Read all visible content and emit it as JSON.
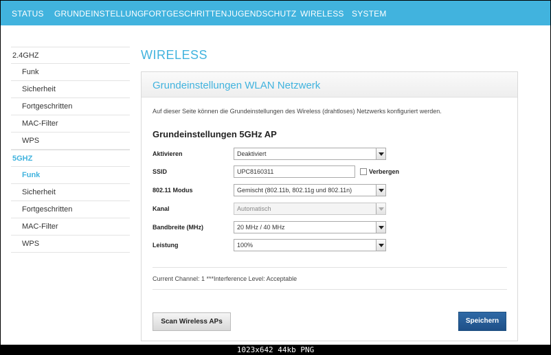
{
  "topnav": {
    "items": [
      "STATUS",
      "GRUNDEINSTELLUNG",
      "FORTGESCHRITTEN",
      "JUGENDSCHUTZ",
      "WIRELESS",
      "SYSTEM"
    ]
  },
  "sidebar": {
    "section_24": "2.4GHZ",
    "items_24": [
      "Funk",
      "Sicherheit",
      "Fortgeschritten",
      "MAC-Filter",
      "WPS"
    ],
    "section_5": "5GHZ",
    "items_5": [
      "Funk",
      "Sicherheit",
      "Fortgeschritten",
      "MAC-Filter",
      "WPS"
    ]
  },
  "page_title": "WIRELESS",
  "panel": {
    "title": "Grundeinstellungen WLAN Netzwerk",
    "description": "Auf dieser Seite können die Grundeinstellungen des Wireless (drahtloses) Netzwerks konfiguriert werden.",
    "subtitle": "Grundeinstellungen 5GHz AP"
  },
  "form": {
    "activate": {
      "label": "Aktivieren",
      "value": "Deaktiviert"
    },
    "ssid": {
      "label": "SSID",
      "value": "UPC8160311",
      "hide_label": "Verbergen"
    },
    "mode": {
      "label": "802.11 Modus",
      "value": "Gemischt (802.11b, 802.11g und 802.11n)"
    },
    "channel": {
      "label": "Kanal",
      "value": "Automatisch"
    },
    "bandwidth": {
      "label": "Bandbreite (MHz)",
      "value": "20 MHz / 40 MHz"
    },
    "power": {
      "label": "Leistung",
      "value": "100%"
    }
  },
  "status_line": "Current Channel: 1 ***Interference Level: Acceptable",
  "buttons": {
    "scan": "Scan Wireless APs",
    "save": "Speichern"
  },
  "caption": "1023x642  44kb  PNG",
  "colors": {
    "accent": "#41b3de",
    "save_button": "#2a5f99"
  }
}
